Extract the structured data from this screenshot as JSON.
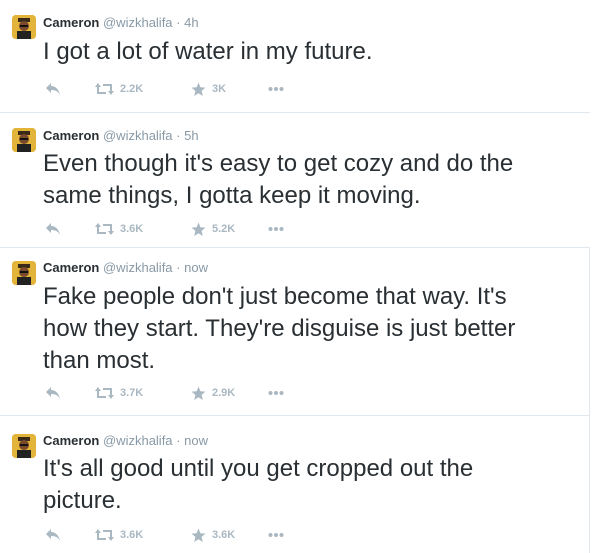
{
  "tweets": [
    {
      "name": "Cameron",
      "handle": "@wizkhalifa",
      "separator": "·",
      "time": "4h",
      "lines": [
        "I got a lot of water in my future."
      ],
      "retweets": "2.2K",
      "favorites": "3K"
    },
    {
      "name": "Cameron",
      "handle": "@wizkhalifa",
      "separator": "·",
      "time": "5h",
      "lines": [
        "Even though it's easy to get cozy and do the",
        "same things, I gotta keep it moving."
      ],
      "retweets": "3.6K",
      "favorites": "5.2K"
    },
    {
      "name": "Cameron",
      "handle": "@wizkhalifa",
      "separator": "·",
      "time": "now",
      "lines": [
        "Fake people don't just become that way. It's",
        "how they start. They're disguise is just better",
        "than most."
      ],
      "retweets": "3.7K",
      "favorites": "2.9K"
    },
    {
      "name": "Cameron",
      "handle": "@wizkhalifa",
      "separator": "·",
      "time": "now",
      "lines": [
        "It's all good until you get cropped out the",
        "picture."
      ],
      "retweets": "3.6K",
      "favorites": "3.6K"
    }
  ],
  "icons": {
    "reply": "reply-icon",
    "retweet": "retweet-icon",
    "favorite": "star-icon",
    "more": "more-dots-icon"
  },
  "colors": {
    "text": "#292f33",
    "meta": "#8899a6",
    "action": "#aab8c2",
    "divider": "#e1e8ed",
    "avatar": "#e3b43a"
  }
}
